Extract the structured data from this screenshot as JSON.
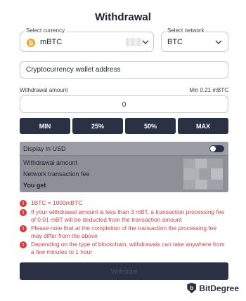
{
  "title": "Withdrawal",
  "currency": {
    "legend": "Select currency",
    "value": "mBTC",
    "icon_symbol": "₿",
    "icon": "bitcoin-icon"
  },
  "network": {
    "legend": "Select network",
    "value": "BTC"
  },
  "wallet": {
    "placeholder": "Cryptocurrency wallet address"
  },
  "amount": {
    "label": "Withdrawal amount",
    "min_label": "Min 0.21 mBTC",
    "value": "0"
  },
  "presets": [
    "MIN",
    "25%",
    "50%",
    "MAX"
  ],
  "usd_panel": {
    "toggle_label": "Display in USD",
    "toggle_on": true,
    "rows": [
      "Withdrawal amount",
      "Network transaction fee",
      "You get"
    ]
  },
  "notices": [
    "1BTC = 1000mBTC",
    "If your withdrawal amount is less than 3 mBT, a transaction processing fee of 0.01 mBT will be deducted from the transaction amount",
    "Please note that at the completion of the transaction the processing fee may differ from the above",
    "Depending on the type of blockchain, withdrawals can take anywhere from a few minutes to 1 hour"
  ],
  "withdraw_button": "Withdraw",
  "brand": "BitDegree",
  "colors": {
    "accent": "#2a3144",
    "warning": "#d24545",
    "coin": "#f3a225"
  }
}
